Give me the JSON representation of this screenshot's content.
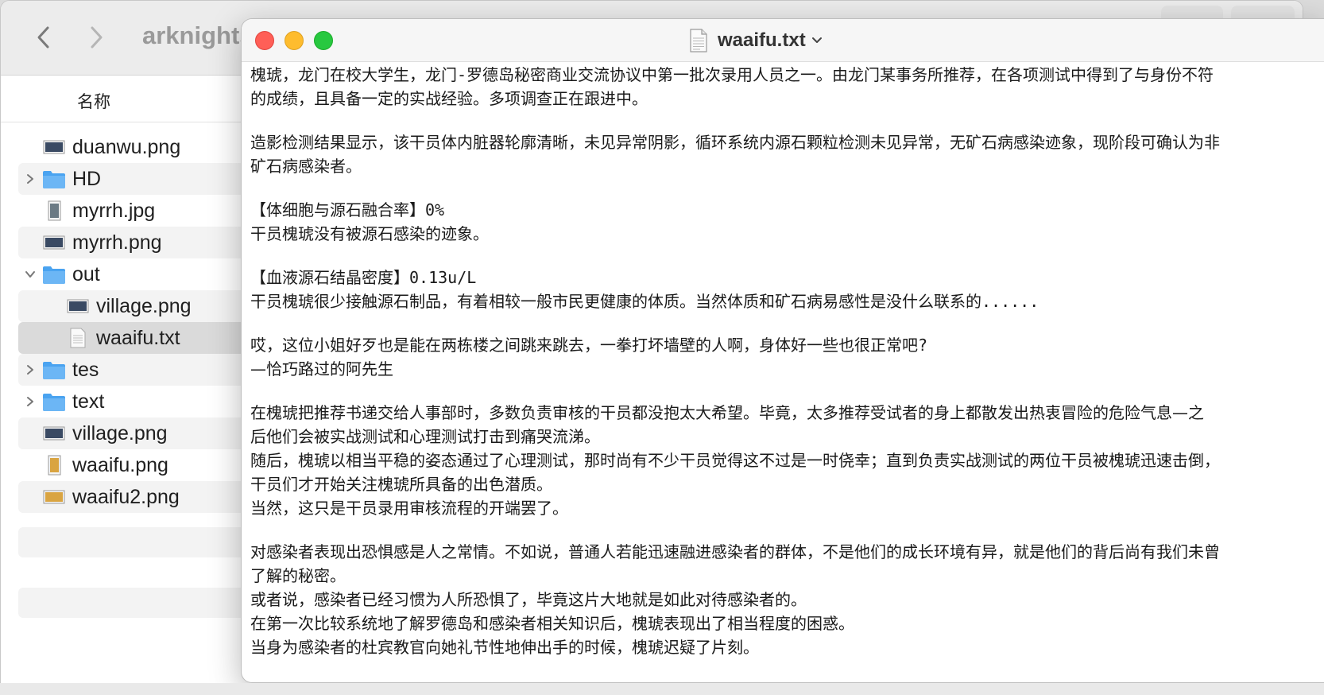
{
  "finder": {
    "title": "arknights",
    "column_header": "名称",
    "files": [
      {
        "name": "duanwu.png",
        "kind": "image",
        "expandable": false,
        "indent": 0,
        "selected": false
      },
      {
        "name": "HD",
        "kind": "folder",
        "expandable": true,
        "expanded": false,
        "indent": 0,
        "selected": false
      },
      {
        "name": "myrrh.jpg",
        "kind": "image",
        "expandable": false,
        "indent": 0,
        "selected": false
      },
      {
        "name": "myrrh.png",
        "kind": "image",
        "expandable": false,
        "indent": 0,
        "selected": false
      },
      {
        "name": "out",
        "kind": "folder",
        "expandable": true,
        "expanded": true,
        "indent": 0,
        "selected": false
      },
      {
        "name": "village.png",
        "kind": "image",
        "expandable": false,
        "indent": 1,
        "selected": false
      },
      {
        "name": "waaifu.txt",
        "kind": "text",
        "expandable": false,
        "indent": 1,
        "selected": true
      },
      {
        "name": "tes",
        "kind": "folder",
        "expandable": true,
        "expanded": false,
        "indent": 0,
        "selected": false
      },
      {
        "name": "text",
        "kind": "folder",
        "expandable": true,
        "expanded": false,
        "indent": 0,
        "selected": false
      },
      {
        "name": "village.png",
        "kind": "image",
        "expandable": false,
        "indent": 0,
        "selected": false
      },
      {
        "name": "waaifu.png",
        "kind": "image",
        "expandable": false,
        "indent": 0,
        "selected": false
      },
      {
        "name": "waaifu2.png",
        "kind": "image",
        "expandable": false,
        "indent": 0,
        "selected": false
      }
    ]
  },
  "textedit": {
    "title": "waaifu.txt",
    "paragraphs": [
      {
        "lines": [
          "槐琥，龙门在校大学生，龙门-罗德岛秘密商业交流协议中第一批次录用人员之一。由龙门某事务所推荐，在各项测试中得到了与身份不符",
          "的成绩，且具备一定的实战经验。多项调查正在跟进中。"
        ]
      },
      {
        "lines": [
          "造影检测结果显示，该干员体内脏器轮廓清晰，未见异常阴影，循环系统内源石颗粒检测未见异常，无矿石病感染迹象，现阶段可确认为非",
          "矿石病感染者。"
        ]
      },
      {
        "lines": [
          "【体细胞与源石融合率】0%",
          "干员槐琥没有被源石感染的迹象。"
        ]
      },
      {
        "lines": [
          "【血液源石结晶密度】0.13u/L",
          "干员槐琥很少接触源石制品，有着相较一般市民更健康的体质。当然体质和矿石病易感性是没什么联系的......"
        ]
      },
      {
        "lines": [
          "哎，这位小姐好歹也是能在两栋楼之间跳来跳去，一拳打坏墙壁的人啊，身体好一些也很正常吧?",
          "—恰巧路过的阿先生"
        ]
      },
      {
        "lines": [
          "在槐琥把推荐书递交给人事部时，多数负责审核的干员都没抱太大希望。毕竟，太多推荐受试者的身上都散发出热衷冒险的危险气息—之",
          "后他们会被实战测试和心理测试打击到痛哭流涕。",
          "随后，槐琥以相当平稳的姿态通过了心理测试，那时尚有不少干员觉得这不过是一时侥幸；直到负责实战测试的两位干员被槐琥迅速击倒，",
          "干员们才开始关注槐琥所具备的出色潜质。",
          "当然，这只是干员录用审核流程的开端罢了。"
        ]
      },
      {
        "lines": [
          "对感染者表现出恐惧感是人之常情。不如说，普通人若能迅速融进感染者的群体，不是他们的成长环境有异，就是他们的背后尚有我们未曾",
          "了解的秘密。",
          "或者说，感染者已经习惯为人所恐惧了，毕竟这片大地就是如此对待感染者的。",
          "在第一次比较系统地了解罗德岛和感染者相关知识后，槐琥表现出了相当程度的困惑。",
          "当身为感染者的杜宾教官向她礼节性地伸出手的时候，槐琥迟疑了片刻。"
        ]
      }
    ]
  },
  "colors": {
    "close": "#ff5f57",
    "minimize": "#febc2e",
    "zoom": "#28c840",
    "folder": "#4aa3f0",
    "selection": "#dadada"
  },
  "icons": {
    "back": "chevron-left-icon",
    "forward": "chevron-right-icon",
    "folder": "folder-icon",
    "image": "image-file-icon",
    "text": "text-file-icon"
  }
}
